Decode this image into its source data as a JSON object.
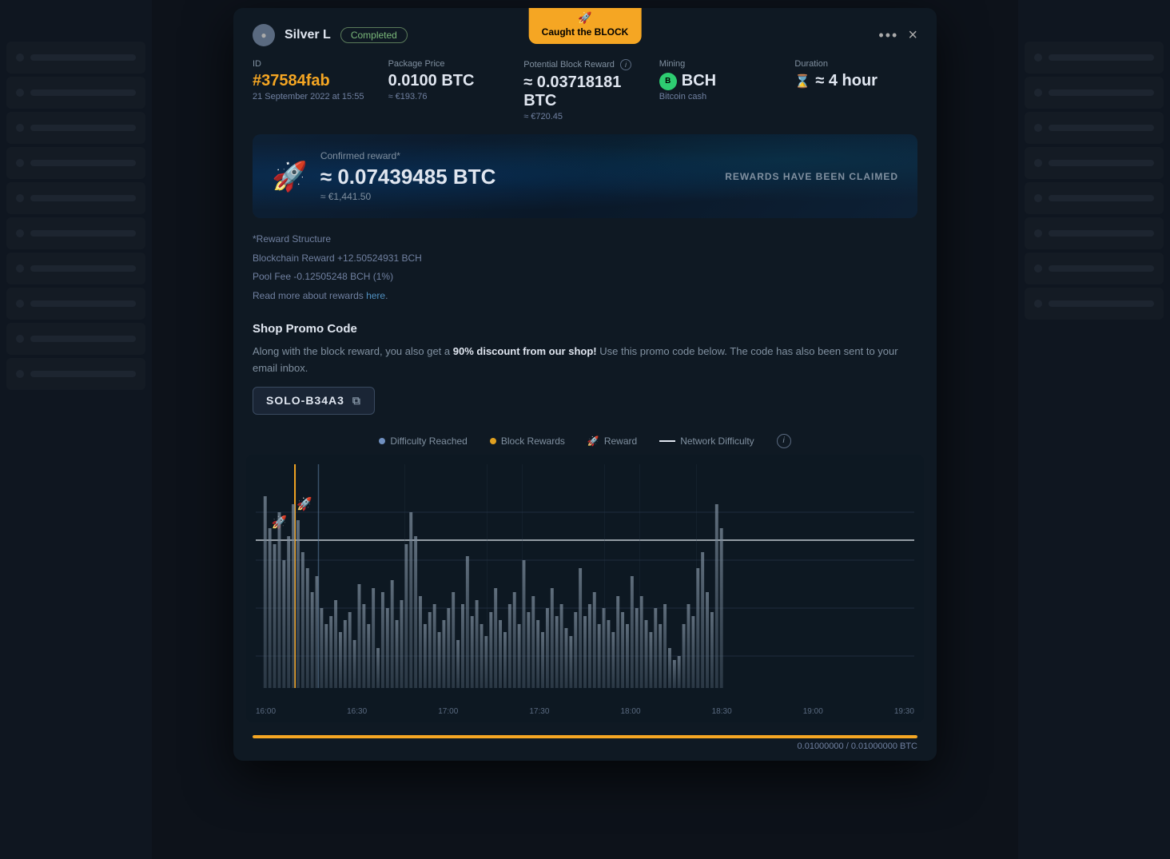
{
  "background": {
    "color": "#1a2535"
  },
  "modal": {
    "caught_badge": {
      "rocket": "🚀",
      "text": "Caught the BLOCK"
    },
    "header": {
      "user_name": "Silver L",
      "status": "Completed",
      "actions": {
        "dots": "•••",
        "close": "×"
      }
    },
    "meta": {
      "id_label": "ID",
      "id_value": "#37584fab",
      "id_date": "21 September 2022 at 15:55",
      "package_price_label": "Package Price",
      "package_price_value": "0.0100 BTC",
      "package_price_eur": "≈ €193.76",
      "potential_reward_label": "Potential Block Reward",
      "potential_reward_value": "≈ 0.03718181 BTC",
      "potential_reward_eur": "≈ €720.45",
      "mining_label": "Mining",
      "mining_coin": "BCH",
      "mining_name": "Bitcoin cash",
      "duration_label": "Duration",
      "duration_value": "≈ 4 hour"
    },
    "reward_banner": {
      "label": "Confirmed reward*",
      "amount": "≈ 0.07439485 BTC",
      "eur": "≈ €1,441.50",
      "claimed_text": "REWARDS HAVE BEEN CLAIMED"
    },
    "reward_structure": {
      "title": "*Reward Structure",
      "blockchain": "Blockchain Reward +12.50524931 BCH",
      "pool_fee": "Pool Fee -0.12505248 BCH (1%)",
      "read_more_pre": "Read more about rewards ",
      "read_more_link": "here",
      "read_more_post": "."
    },
    "promo": {
      "title": "Shop Promo Code",
      "description_pre": "Along with the block reward, you also get a ",
      "description_highlight": "90% discount from our shop!",
      "description_post": " Use this promo code below. The code has also been sent to your email inbox.",
      "code": "SOLO-B34A3"
    },
    "legend": {
      "difficulty_reached_label": "Difficulty Reached",
      "difficulty_reached_color": "#7090c0",
      "block_rewards_label": "Block Rewards",
      "block_rewards_color": "#e0a020",
      "reward_label": "Reward",
      "reward_rocket": "🚀",
      "network_difficulty_label": "Network Difficulty",
      "network_difficulty_color": "#e0e6f0"
    },
    "chart": {
      "time_labels": [
        "16:00",
        "16:30",
        "17:00",
        "17:30",
        "18:00",
        "18:30",
        "19:00",
        "19:30"
      ]
    },
    "progress": {
      "fill_percent": 100,
      "label": "0.01000000 / 0.01000000 BTC"
    }
  }
}
